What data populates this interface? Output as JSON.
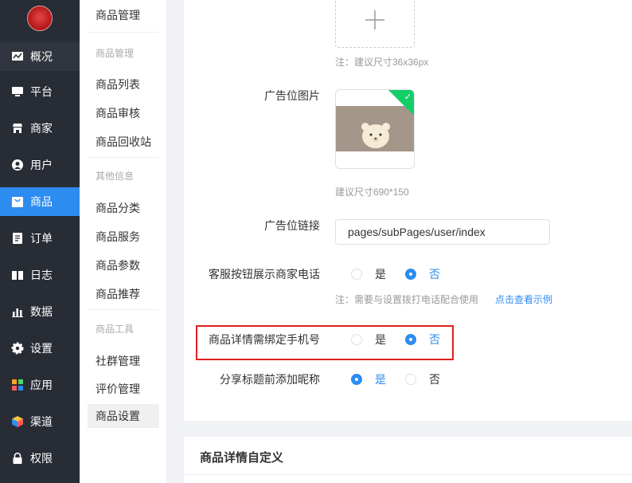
{
  "nav": {
    "items": [
      {
        "label": "概况",
        "icon": "overview-icon"
      },
      {
        "label": "平台",
        "icon": "platform-icon"
      },
      {
        "label": "商家",
        "icon": "merchant-icon"
      },
      {
        "label": "用户",
        "icon": "user-icon"
      },
      {
        "label": "商品",
        "icon": "goods-icon"
      },
      {
        "label": "订单",
        "icon": "order-icon"
      },
      {
        "label": "日志",
        "icon": "log-icon"
      },
      {
        "label": "数据",
        "icon": "data-icon"
      },
      {
        "label": "设置",
        "icon": "settings-icon"
      },
      {
        "label": "应用",
        "icon": "apps-icon"
      },
      {
        "label": "渠道",
        "icon": "channel-icon"
      },
      {
        "label": "权限",
        "icon": "lock-icon"
      }
    ],
    "active": "商品"
  },
  "subnav": {
    "title": "商品管理",
    "groups": [
      {
        "label": "商品管理",
        "items": [
          "商品列表",
          "商品审核",
          "商品回收站"
        ]
      },
      {
        "label": "其他信息",
        "items": [
          "商品分类",
          "商品服务",
          "商品参数",
          "商品推荐"
        ]
      },
      {
        "label": "商品工具",
        "items": [
          "社群管理",
          "评价管理",
          "商品设置"
        ]
      }
    ],
    "active": "商品设置"
  },
  "form": {
    "icon_hint": "注：建议尺寸36x36px",
    "ad_image_label": "广告位图片",
    "ad_image_hint": "建议尺寸690*150",
    "ad_link_label": "广告位链接",
    "ad_link_value": "pages/subPages/user/index",
    "service_phone_label": "客服按钮展示商家电话",
    "service_phone_hint": "注：需要与设置拨打电话配合使用",
    "service_phone_link": "点击查看示例",
    "bind_phone_label": "商品详情需绑定手机号",
    "share_nick_label": "分享标题前添加昵称",
    "yes": "是",
    "no": "否",
    "service_phone_value": "否",
    "bind_phone_value": "否",
    "share_nick_value": "是"
  },
  "section2": {
    "title": "商品详情自定义"
  },
  "colors": {
    "accent": "#2d8cf0",
    "nav_bg": "#282c34",
    "highlight_box": "#e02020",
    "success": "#13ce66"
  }
}
